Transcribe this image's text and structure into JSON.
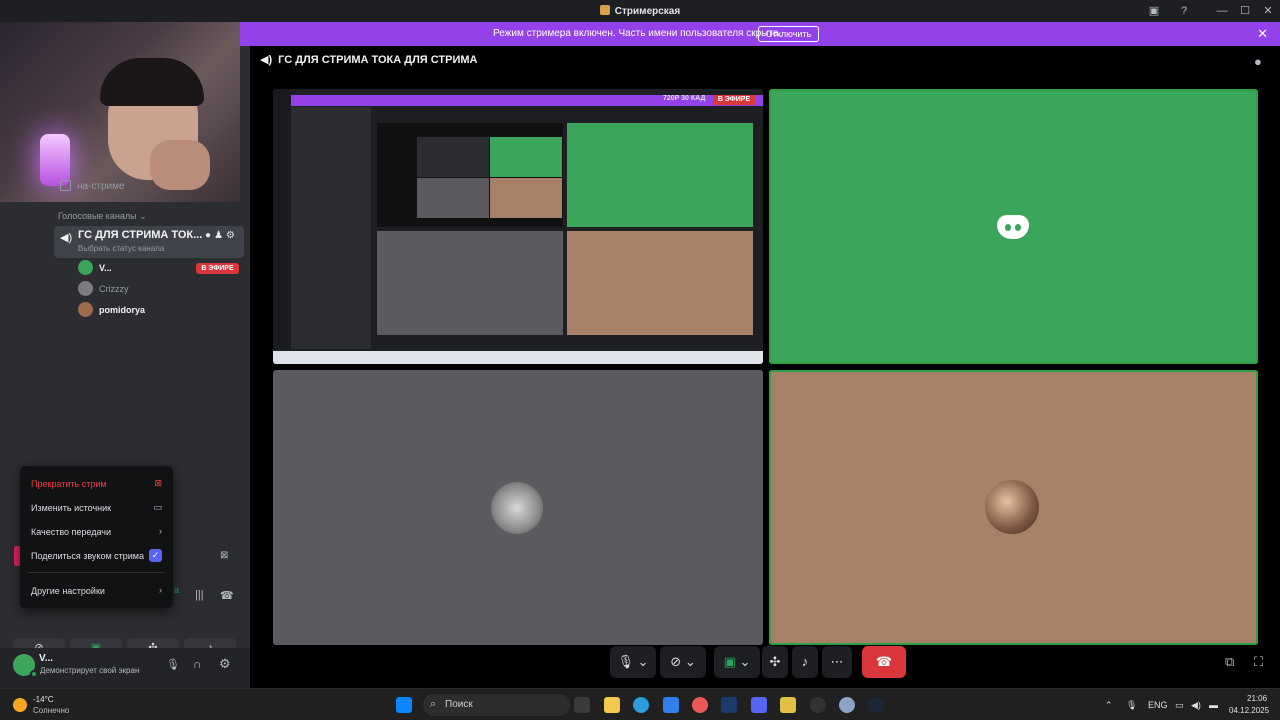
{
  "window": {
    "title": "Стримерская"
  },
  "banner": {
    "text": "Режим стримера включен. Часть имени пользователя скрыта.",
    "button": "Отключить"
  },
  "sidebar": {
    "text_channel": "на-стриме",
    "voice_category": "Голосовые каналы",
    "voice_channel": {
      "name": "ГС ДЛЯ СТРИМА ТОК...",
      "status": "Выбрать статус канала"
    },
    "users": [
      {
        "name": "V...",
        "badge": "В ЭФИРЕ",
        "color": "#3ba55c"
      },
      {
        "name": "Crizzzy",
        "color": "#7b7b80"
      },
      {
        "name": "pomidorya",
        "color": "#a06b4f"
      }
    ]
  },
  "stream_menu": {
    "items": [
      {
        "label": "Прекратить стрим",
        "icon": "stop-stream-icon"
      },
      {
        "label": "Изменить источник",
        "icon": "monitor-icon"
      },
      {
        "label": "Качество передачи",
        "icon": "chevron-right-icon"
      },
      {
        "label": "Поделиться звуком стрима",
        "checked": true
      },
      {
        "label": "Другие настройки",
        "icon": "chevron-right-icon"
      }
    ]
  },
  "voice_panel": {
    "partial_label": "a"
  },
  "userbar": {
    "name": "V...",
    "status": "Демонстрирует свой экран"
  },
  "main": {
    "channel_header": "ГС ДЛЯ СТРИМА ТОКА ДЛЯ СТРИМА",
    "preview_live_label": "720P 30 КАД",
    "preview_live_badge": "В ЭФИРЕ"
  },
  "taskbar": {
    "weather_temp": "-14°C",
    "weather_desc": "Солнечно",
    "search_placeholder": "Поиск",
    "lang": "ENG",
    "time": "21:06",
    "date": "04.12.2025"
  },
  "colors": {
    "accent": "#5865f2",
    "danger": "#da373c",
    "banner": "#9242e8",
    "speaking": "#2ea043"
  }
}
